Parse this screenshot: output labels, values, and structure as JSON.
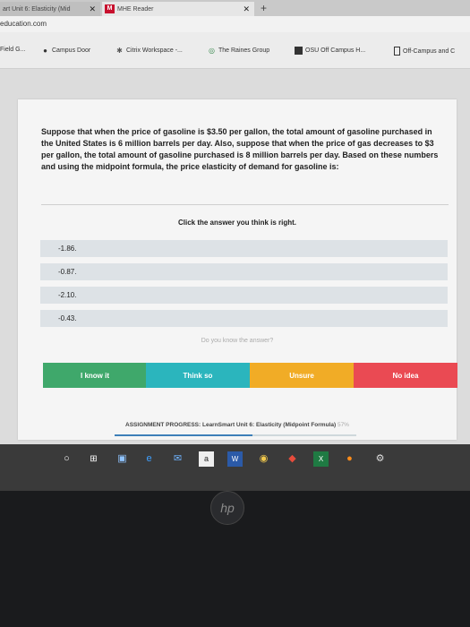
{
  "browser": {
    "tabs": [
      {
        "label": "art Unit 6: Elasticity (Mid"
      },
      {
        "label": "MHE Reader"
      }
    ],
    "url": "education.com",
    "bookmarks": [
      {
        "label": "Field G...",
        "icon": "folder-icon"
      },
      {
        "label": "Campus Door",
        "icon": "door-icon"
      },
      {
        "label": "Citrix Workspace -...",
        "icon": "citrix-icon"
      },
      {
        "label": "The Raines Group",
        "icon": "globe-icon"
      },
      {
        "label": "OSU Off Campus H...",
        "icon": "square-icon"
      },
      {
        "label": "Off-Campus and C",
        "icon": "rect-icon"
      }
    ]
  },
  "question": {
    "text": "Suppose that when the price of gasoline is $3.50 per gallon, the total amount of gasoline purchased in the United States is 6 million barrels per day. Also, suppose that when the price of gas decreases to $3 per gallon, the total amount of gasoline purchased is 8 million barrels per day. Based on these numbers and using the midpoint formula, the price elasticity of demand for gasoline is:"
  },
  "prompt": "Click the answer you think is right.",
  "options": [
    {
      "label": "-1.86."
    },
    {
      "label": "-0.87."
    },
    {
      "label": "-2.10."
    },
    {
      "label": "-0.43."
    }
  ],
  "hint": "Do you know the answer?",
  "confidence": {
    "know": "I know it",
    "think": "Think so",
    "unsure": "Unsure",
    "noidea": "No idea"
  },
  "progress": {
    "label": "ASSIGNMENT PROGRESS: LearnSmart Unit 6: Elasticity (Midpoint Formula)",
    "percent_text": "57%",
    "value": 0.57
  },
  "taskbar": {
    "icons": [
      "start-circle-icon",
      "task-view-icon",
      "store-icon",
      "edge-icon",
      "mail-icon",
      "amazon-icon",
      "word-icon",
      "chrome-icon",
      "app-icon",
      "excel-icon",
      "firefox-icon",
      "settings-gear-icon"
    ]
  },
  "hp_logo": "hp"
}
